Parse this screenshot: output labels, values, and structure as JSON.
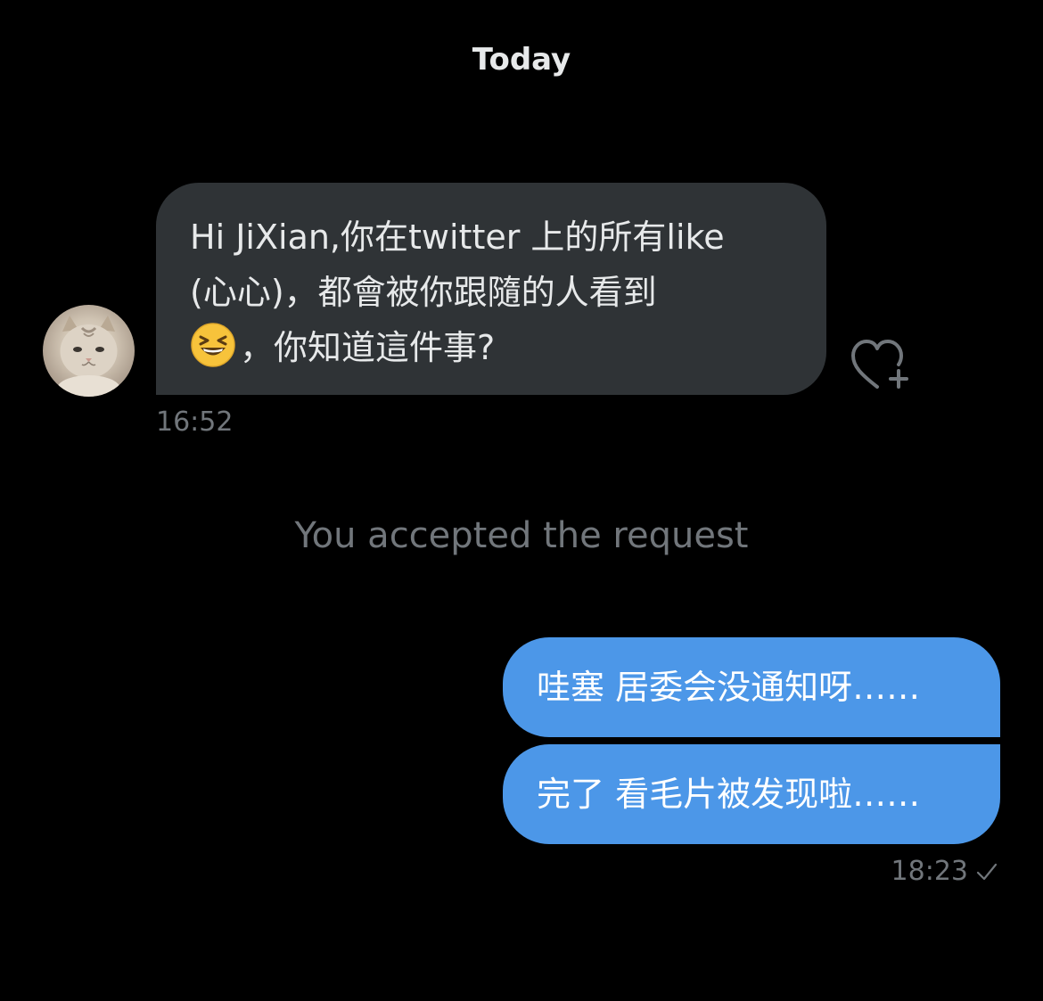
{
  "header": {
    "date_label": "Today"
  },
  "incoming_message": {
    "lines": [
      "Hi JiXian,你在twitter 上的所有like",
      "(心心)，都會被你跟隨的人看到",
      "，你知道這件事?"
    ],
    "emoji": "😆",
    "time": "16:52",
    "react_icon": "heart-plus-icon"
  },
  "system_note": "You accepted the request",
  "outgoing_messages": [
    {
      "text": "哇塞 居委会没通知呀……"
    },
    {
      "text": "完了 看毛片被发现啦……"
    }
  ],
  "outgoing_time": "18:23",
  "status_icon": "checkmark-icon",
  "colors": {
    "background": "#000000",
    "incoming_bubble": "#2f3336",
    "outgoing_bubble": "#4c97e8",
    "muted_text": "#71767b"
  }
}
